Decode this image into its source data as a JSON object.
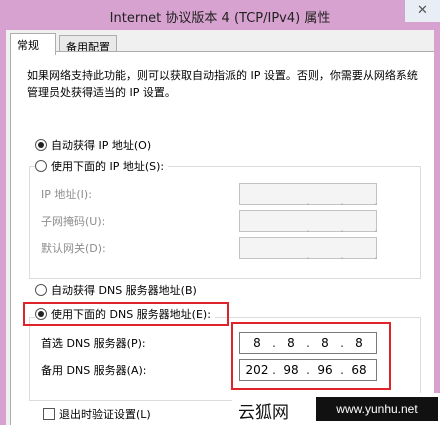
{
  "window": {
    "title": "Internet 协议版本 4 (TCP/IPv4) 属性",
    "close_glyph": "✕"
  },
  "tabs": [
    {
      "label": "常规",
      "active": true
    },
    {
      "label": "备用配置",
      "active": false
    }
  ],
  "description": "如果网络支持此功能，则可以获取自动指派的 IP 设置。否则，你需要从网络系统管理员处获得适当的 IP 设置。",
  "ip": {
    "auto_label": "自动获得 IP 地址(O)",
    "auto_checked": true,
    "manual_label": "使用下面的 IP 地址(S):",
    "manual_checked": false,
    "fields": [
      {
        "label": "IP 地址(I):",
        "octets": [
          "",
          "",
          "",
          ""
        ]
      },
      {
        "label": "子网掩码(U):",
        "octets": [
          "",
          "",
          "",
          ""
        ]
      },
      {
        "label": "默认网关(D):",
        "octets": [
          "",
          "",
          "",
          ""
        ]
      }
    ]
  },
  "dns": {
    "auto_label": "自动获得 DNS 服务器地址(B)",
    "auto_checked": false,
    "manual_label": "使用下面的 DNS 服务器地址(E):",
    "manual_checked": true,
    "preferred_label": "首选 DNS 服务器(P):",
    "preferred_octets": [
      "8",
      "8",
      "8",
      "8"
    ],
    "alternate_label": "备用 DNS 服务器(A):",
    "alternate_octets": [
      "202",
      "98",
      "96",
      "68"
    ]
  },
  "validate_label": "退出时验证设置(L)",
  "validate_checked": false,
  "highlight_color": "#e0222a",
  "title_bar_color": "#d7a2cf",
  "watermark": {
    "name": "云狐网",
    "url": "www.yunhu.net"
  }
}
